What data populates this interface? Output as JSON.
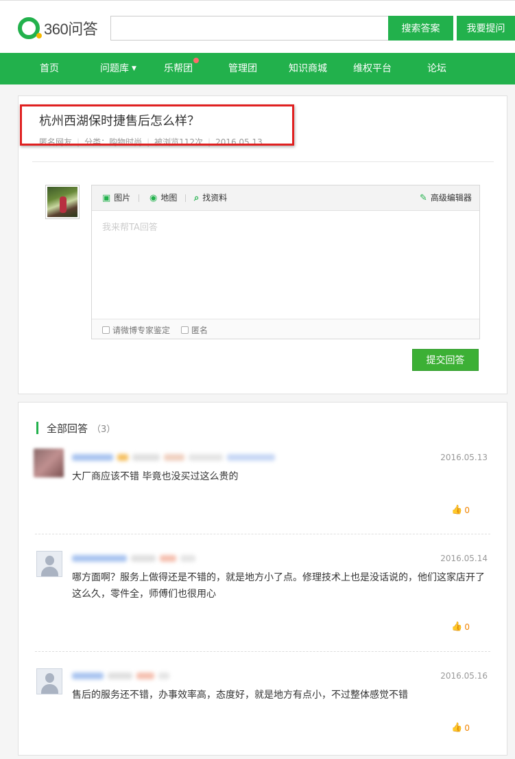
{
  "header": {
    "logo_text": "360问答",
    "search_placeholder": "",
    "search_button": "搜索答案",
    "ask_button": "我要提问"
  },
  "nav": {
    "items": [
      "首页",
      "问题库",
      "乐帮团",
      "管理团",
      "知识商城",
      "维权平台",
      "论坛"
    ]
  },
  "question": {
    "title": "杭州西湖保时捷售后怎么样？",
    "author": "匿名网友",
    "category": "分类：购物时尚",
    "views": "被浏览112次",
    "date": "2016.05.13"
  },
  "editor": {
    "tool_image": "图片",
    "tool_map": "地图",
    "tool_search": "找资料",
    "tool_advanced": "高级编辑器",
    "placeholder": "我来帮TA回答",
    "check_expert": "请微博专家鉴定",
    "check_anon": "匿名",
    "submit": "提交回答"
  },
  "answers_section": {
    "title": "全部回答",
    "count": "（3）"
  },
  "answers": [
    {
      "date": "2016.05.13",
      "text": "大厂商应该不错   毕竟也没买过这么贵的",
      "likes": "0"
    },
    {
      "date": "2016.05.14",
      "text": "哪方面啊？服务上做得还是不错的，就是地方小了点。修理技术上也是没话说的，他们这家店开了这么久，零件全，师傅们也很用心",
      "likes": "0"
    },
    {
      "date": "2016.05.16",
      "text": "售后的服务还不错，办事效率高，态度好，就是地方有点小，不过整体感觉不错",
      "likes": "0"
    }
  ],
  "colors": {
    "brand_green": "#22b14c",
    "highlight_red": "#e02020",
    "like_orange": "#f08300"
  }
}
